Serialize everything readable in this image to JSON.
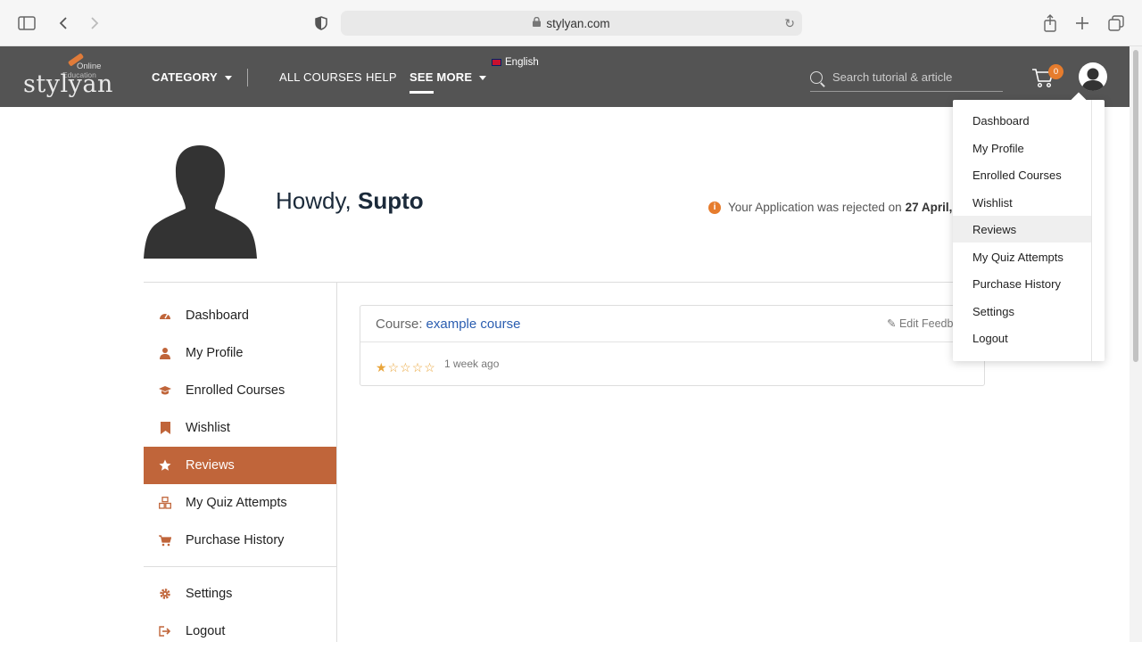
{
  "browser": {
    "url": "stylyan.com"
  },
  "header": {
    "logo_main": "stylyan",
    "logo_sub1": "Online",
    "logo_sub2": "Education",
    "nav": {
      "category": "CATEGORY",
      "all_courses": "ALL COURSES",
      "help": "HELP",
      "see_more": "SEE MORE"
    },
    "language": "English",
    "search_placeholder": "Search tutorial & article",
    "cart_count": "0"
  },
  "profile": {
    "greeting": "Howdy, ",
    "name": "Supto",
    "notice_text": "Your Application was rejected on",
    "notice_date": "27 April,"
  },
  "sidebar": {
    "items": [
      {
        "label": "Dashboard",
        "icon": "dashboard-icon"
      },
      {
        "label": "My Profile",
        "icon": "user-icon"
      },
      {
        "label": "Enrolled Courses",
        "icon": "graduation-cap-icon"
      },
      {
        "label": "Wishlist",
        "icon": "bookmark-icon"
      },
      {
        "label": "Reviews",
        "icon": "star-icon"
      },
      {
        "label": "My Quiz Attempts",
        "icon": "quiz-icon"
      },
      {
        "label": "Purchase History",
        "icon": "cart-icon"
      },
      {
        "label": "Settings",
        "icon": "gear-icon"
      },
      {
        "label": "Logout",
        "icon": "logout-icon"
      }
    ],
    "active": "Reviews"
  },
  "review": {
    "course_prefix": "Course:",
    "course_name": "example course",
    "edit_label": "Edit Feedba",
    "rating": 1,
    "max_rating": 5,
    "time": "1 week ago"
  },
  "dropdown": {
    "items": [
      "Dashboard",
      "My Profile",
      "Enrolled Courses",
      "Wishlist",
      "Reviews",
      "My Quiz Attempts",
      "Purchase History",
      "Settings",
      "Logout"
    ],
    "hovered": "Reviews"
  },
  "colors": {
    "accent": "#c0653a",
    "header_bg": "#545454",
    "badge": "#e67c2d",
    "link": "#2a5db0"
  }
}
